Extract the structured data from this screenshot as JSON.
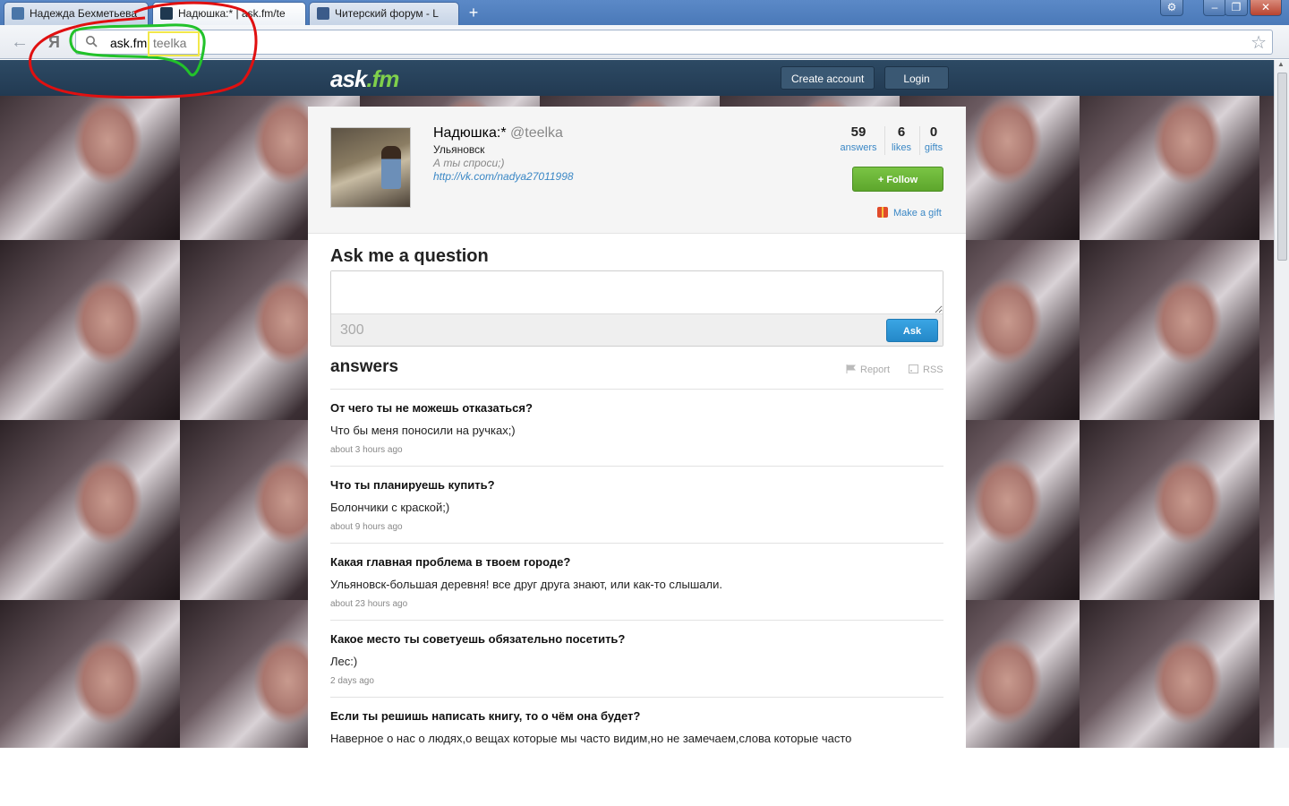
{
  "browser": {
    "tabs": [
      {
        "title": "Надежда Бехметьева",
        "active": false,
        "favicon_color": "#4a76a8"
      },
      {
        "title": "Надюшка:* | ask.fm/te",
        "active": true,
        "favicon_color": "#1f3850"
      },
      {
        "title": "Читерский форум - L",
        "active": false,
        "favicon_color": "#3b5b8a"
      }
    ],
    "new_tab": "+",
    "window_controls": {
      "settings": "⚙",
      "minimize": "–",
      "maximize": "❐",
      "close": "✕"
    },
    "nav": {
      "back": "←",
      "yandex": "Я"
    },
    "address": {
      "host": "ask.fm",
      "path": "teelka",
      "star": "☆"
    }
  },
  "header": {
    "logo_main": "ask",
    "logo_accent": ".fm",
    "create_account": "Create account",
    "login": "Login"
  },
  "profile": {
    "name": "Надюшка:*",
    "username": "@teelka",
    "city": "Ульяновск",
    "bio": "А ты спроси;)",
    "link": "http://vk.com/nadya27011998",
    "stats": [
      {
        "value": "59",
        "label": "answers"
      },
      {
        "value": "6",
        "label": "likes"
      },
      {
        "value": "0",
        "label": "gifts"
      }
    ],
    "follow": "+ Follow",
    "gift": "Make a gift"
  },
  "ask": {
    "title": "Ask me a question",
    "placeholder": "",
    "counter": "300",
    "button": "Ask"
  },
  "answers": {
    "title": "answers",
    "report": "Report",
    "rss": "RSS",
    "items": [
      {
        "question": "От чего ты не можешь отказаться?",
        "answer": "Что бы меня поносили на ручках;)",
        "time": "about 3 hours ago"
      },
      {
        "question": "Что ты планируешь купить?",
        "answer": "Болончики с краской;)",
        "time": "about 9 hours ago"
      },
      {
        "question": "Какая главная проблема в твоем городе?",
        "answer": "Ульяновск-большая деревня! все друг друга знают, или как-то слышали.",
        "time": "about 23 hours ago"
      },
      {
        "question": "Какое место ты советуешь обязательно посетить?",
        "answer": "Лес:)",
        "time": "2 days ago"
      },
      {
        "question": "Если ты решишь написать книгу, то о чём она будет?",
        "answer": "Наверное о нас о людях,о вещах которые мы часто видим,но не замечаем,слова которые часто",
        "time": ""
      }
    ]
  },
  "colors": {
    "annotation_red": "#e01010",
    "annotation_green": "#22c22a",
    "annotation_yellow": "#f2e84a",
    "brand_green": "#7fd04b",
    "link_blue": "#3a87c5"
  }
}
